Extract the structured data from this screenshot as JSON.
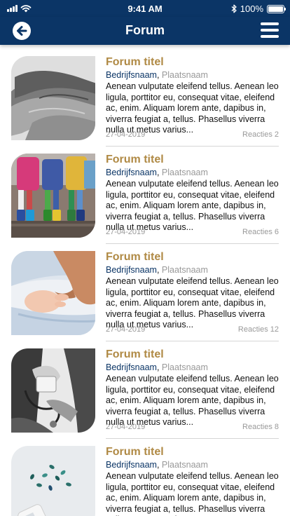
{
  "status_bar": {
    "time": "9:41 AM",
    "battery": "100%",
    "battery_level": 1.0,
    "icons": [
      "signal-icon",
      "wifi-icon",
      "bluetooth-icon",
      "battery-icon"
    ]
  },
  "header": {
    "title": "Forum",
    "back_icon": "arrow-left-circle-icon",
    "menu_icon": "hamburger-menu-icon",
    "color": "#0b3566"
  },
  "colors": {
    "title": "#b08a45",
    "company": "#0b3566",
    "muted": "#999999"
  },
  "posts": [
    {
      "title": "Forum titel",
      "company": "Bedrijfsnaam",
      "place": "Plaatsnaam",
      "excerpt": "Aenean vulputate eleifend tellus. Aenean leo ligula, porttitor eu, consequat vitae, eleifend ac, enim. Aliquam lorem ante, dapibus in, viverra feugiat a, tellus. Phasellus viverra nulla ut metus varius...",
      "date": "27-04-2019",
      "reactions": "Reacties 2",
      "image": "stacked-hands-photo"
    },
    {
      "title": "Forum titel",
      "company": "Bedrijfsnaam",
      "place": "Plaatsnaam",
      "excerpt": "Aenean vulputate eleifend tellus. Aenean leo ligula, porttitor eu, consequat vitae, eleifend ac, enim. Aliquam lorem ante, dapibus in, viverra feugiat a, tellus. Phasellus viverra nulla ut metus varius...",
      "date": "27-04-2019",
      "reactions": "Reacties 6",
      "image": "children-rain-boots-photo"
    },
    {
      "title": "Forum titel",
      "company": "Bedrijfsnaam",
      "place": "Plaatsnaam",
      "excerpt": "Aenean vulputate eleifend tellus. Aenean leo ligula, porttitor eu, consequat vitae, eleifend ac, enim. Aliquam lorem ante, dapibus in, viverra feugiat a, tellus. Phasellus viverra nulla ut metus varius...",
      "date": "27-04-2019",
      "reactions": "Reacties 12",
      "image": "baby-hand-photo"
    },
    {
      "title": "Forum titel",
      "company": "Bedrijfsnaam",
      "place": "Plaatsnaam",
      "excerpt": "Aenean vulputate eleifend tellus. Aenean leo ligula, porttitor eu, consequat vitae, eleifend ac, enim. Aliquam lorem ante, dapibus in, viverra feugiat a, tellus. Phasellus viverra nulla ut metus varius...",
      "date": "27-04-2019",
      "reactions": "Reacties 8",
      "image": "blood-pressure-photo"
    },
    {
      "title": "Forum titel",
      "company": "Bedrijfsnaam",
      "place": "Plaatsnaam",
      "excerpt": "Aenean vulputate eleifend tellus. Aenean leo ligula, porttitor eu, consequat vitae, eleifend ac, enim. Aliquam lorem ante, dapibus in, viverra feugiat a, tellus. Phasellus viverra nulla ut metus varius...",
      "date": "",
      "reactions": "",
      "image": "pills-bottle-photo"
    }
  ]
}
